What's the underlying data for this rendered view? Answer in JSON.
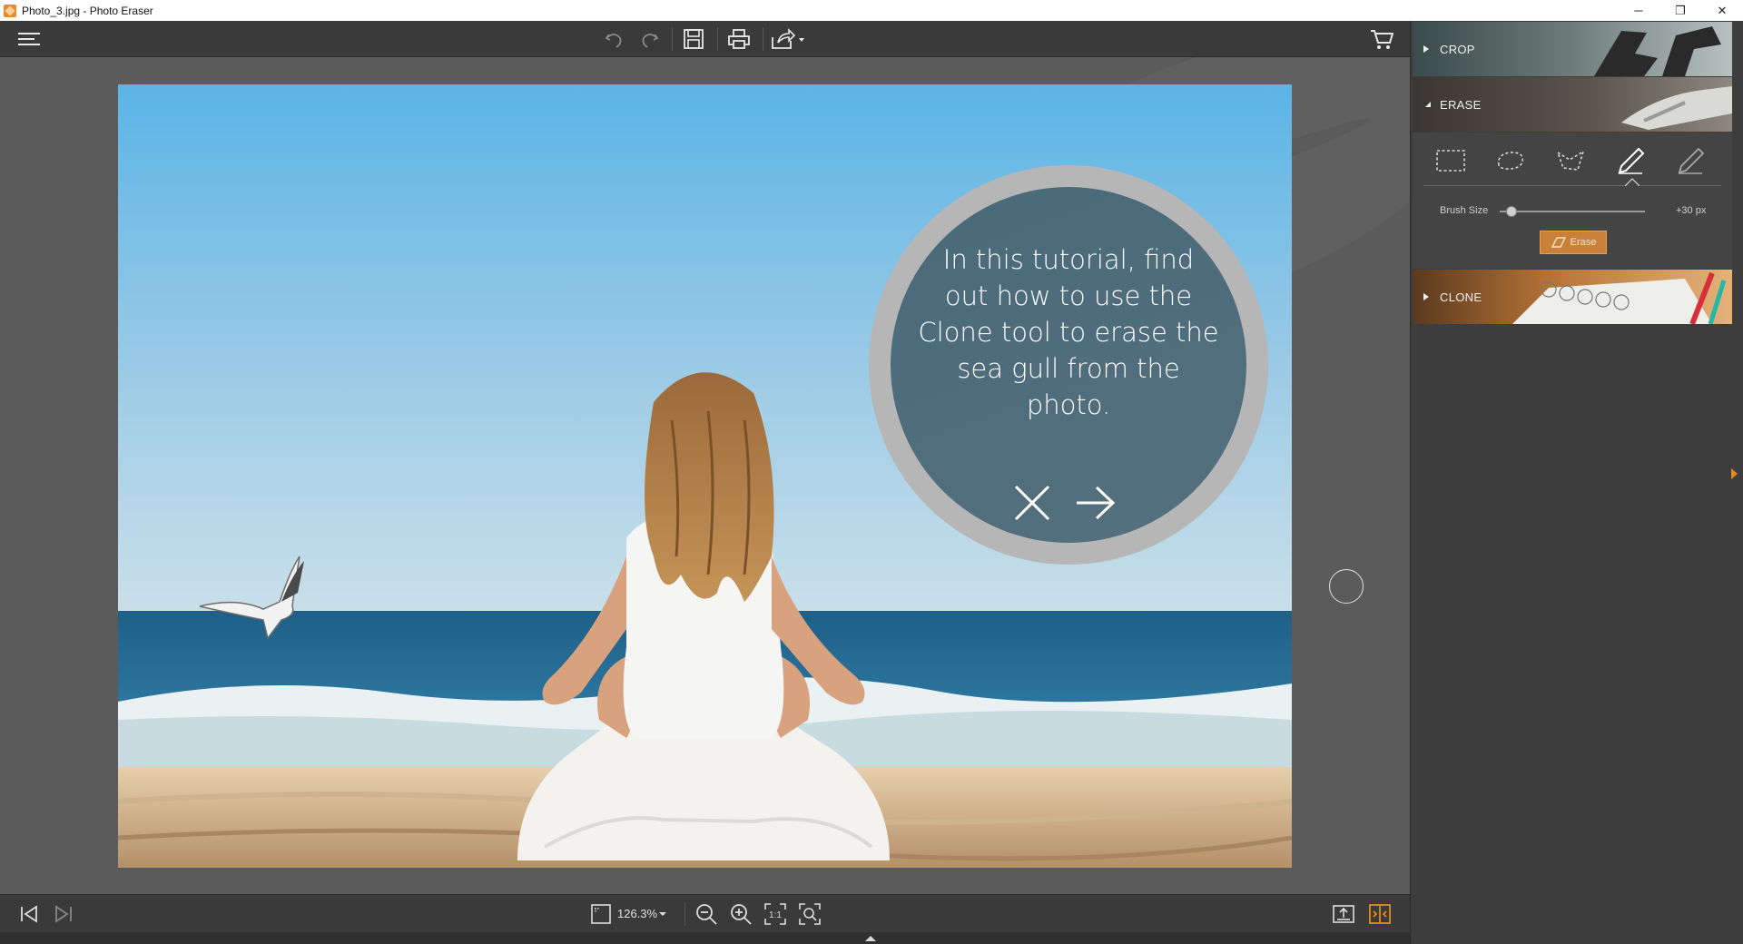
{
  "window": {
    "title": "Photo_3.jpg - Photo Eraser",
    "controls": {
      "minimize": "─",
      "restore": "❐",
      "close": "✕"
    }
  },
  "toolbar": {
    "icons": [
      "menu-icon",
      "undo-icon",
      "redo-icon",
      "save-icon",
      "print-icon",
      "share-icon",
      "cart-icon"
    ]
  },
  "tutorial": {
    "text": "In this tutorial, find out how to use the Clone tool to erase the sea gull from the photo.",
    "close_icon": "close-icon",
    "next_icon": "arrow-right-icon"
  },
  "bottombar": {
    "zoom": "126.3%",
    "icons": [
      "first-image-icon",
      "last-image-icon",
      "zoom-preset-icon",
      "zoom-out-icon",
      "zoom-in-icon",
      "actual-size-icon",
      "fit-window-icon",
      "export-icon",
      "compare-icon"
    ]
  },
  "panel": {
    "sections": [
      {
        "label": "CROP",
        "expanded": false
      },
      {
        "label": "ERASE",
        "expanded": true
      },
      {
        "label": "CLONE",
        "expanded": false
      }
    ],
    "erase": {
      "tools": [
        "rectangle-select-icon",
        "lasso-icon",
        "polygon-lasso-icon",
        "brush-icon",
        "eraser-brush-icon"
      ],
      "active_tool": "brush-icon",
      "brush_size_label": "Brush Size",
      "brush_size_value": "+30 px",
      "brush_size_fraction": 0.08,
      "erase_button": "Erase"
    }
  },
  "colors": {
    "accent": "#c9813a",
    "panel": "#3d3d3d",
    "canvas": "#5b5b5b",
    "tutorial": "#4f6d7c"
  }
}
